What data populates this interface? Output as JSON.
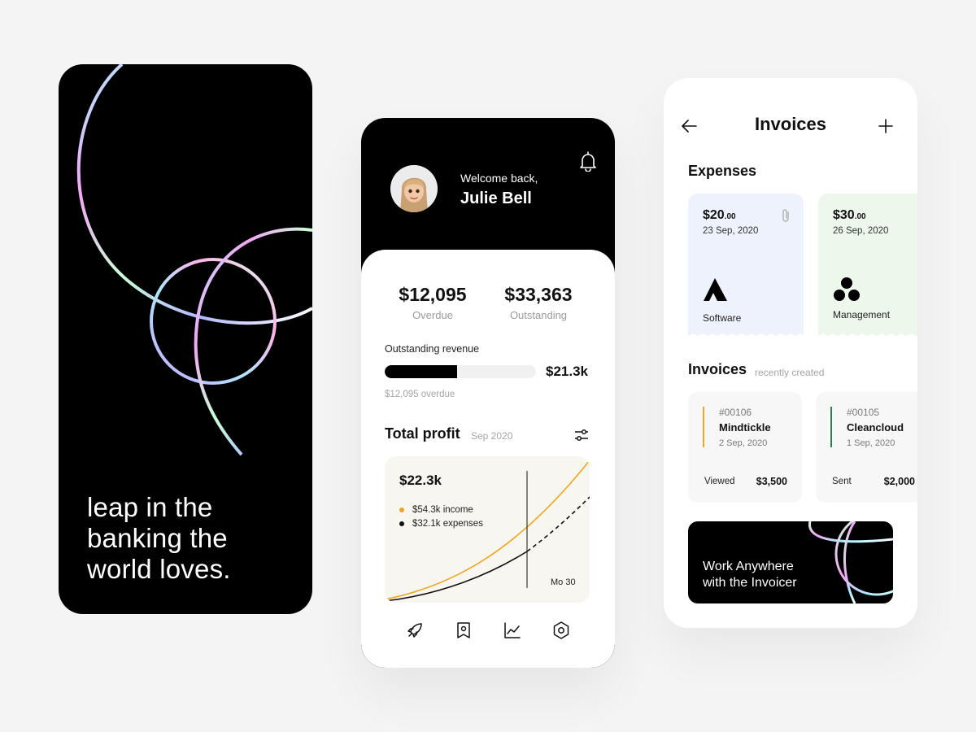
{
  "onboarding": {
    "tagline": "leap in the\nbanking the\nworld loves."
  },
  "dashboard": {
    "welcome": "Welcome back,",
    "user_name": "Julie Bell",
    "stats": [
      {
        "value": "$12,095",
        "label": "Overdue"
      },
      {
        "value": "$33,363",
        "label": "Outstanding"
      }
    ],
    "revenue": {
      "label": "Outstanding revenue",
      "value": "$21.3k",
      "progress": 0.48,
      "overdue_note": "$12,095 overdue"
    },
    "profit": {
      "title": "Total profit",
      "period": "Sep 2020",
      "total": "$22.3k",
      "legend": [
        {
          "label": "$54.3k income",
          "color": "#f0a41c"
        },
        {
          "label": "$32.1k expenses",
          "color": "#111111"
        }
      ],
      "marker_label": "Mo 30"
    },
    "tabs": [
      "rocket-icon",
      "receipt-icon",
      "chart-icon",
      "settings-icon"
    ]
  },
  "invoices_screen": {
    "title": "Invoices",
    "expenses_title": "Expenses",
    "expenses": [
      {
        "amount": "$20",
        "cents": ".00",
        "date": "23 Sep, 2020",
        "category": "Software"
      },
      {
        "amount": "$30",
        "cents": ".00",
        "date": "26 Sep, 2020",
        "category": "Management"
      }
    ],
    "invoices_title": "Invoices",
    "invoices_subtitle": "recently created",
    "invoices": [
      {
        "number": "#00106",
        "name": "Mindtickle",
        "date": "2 Sep, 2020",
        "status": "Viewed",
        "amount": "$3,500",
        "accent": "#f0a41c"
      },
      {
        "number": "#00105",
        "name": "Cleancloud",
        "date": "1 Sep, 2020",
        "status": "Sent",
        "amount": "$2,000",
        "accent": "#2e7d5b"
      }
    ],
    "promo": "Work Anywhere\nwith the Invoicer"
  },
  "colors": {
    "accent_orange": "#f0a41c",
    "expense_blue": "#eef2fd",
    "expense_green": "#edf7ec"
  }
}
